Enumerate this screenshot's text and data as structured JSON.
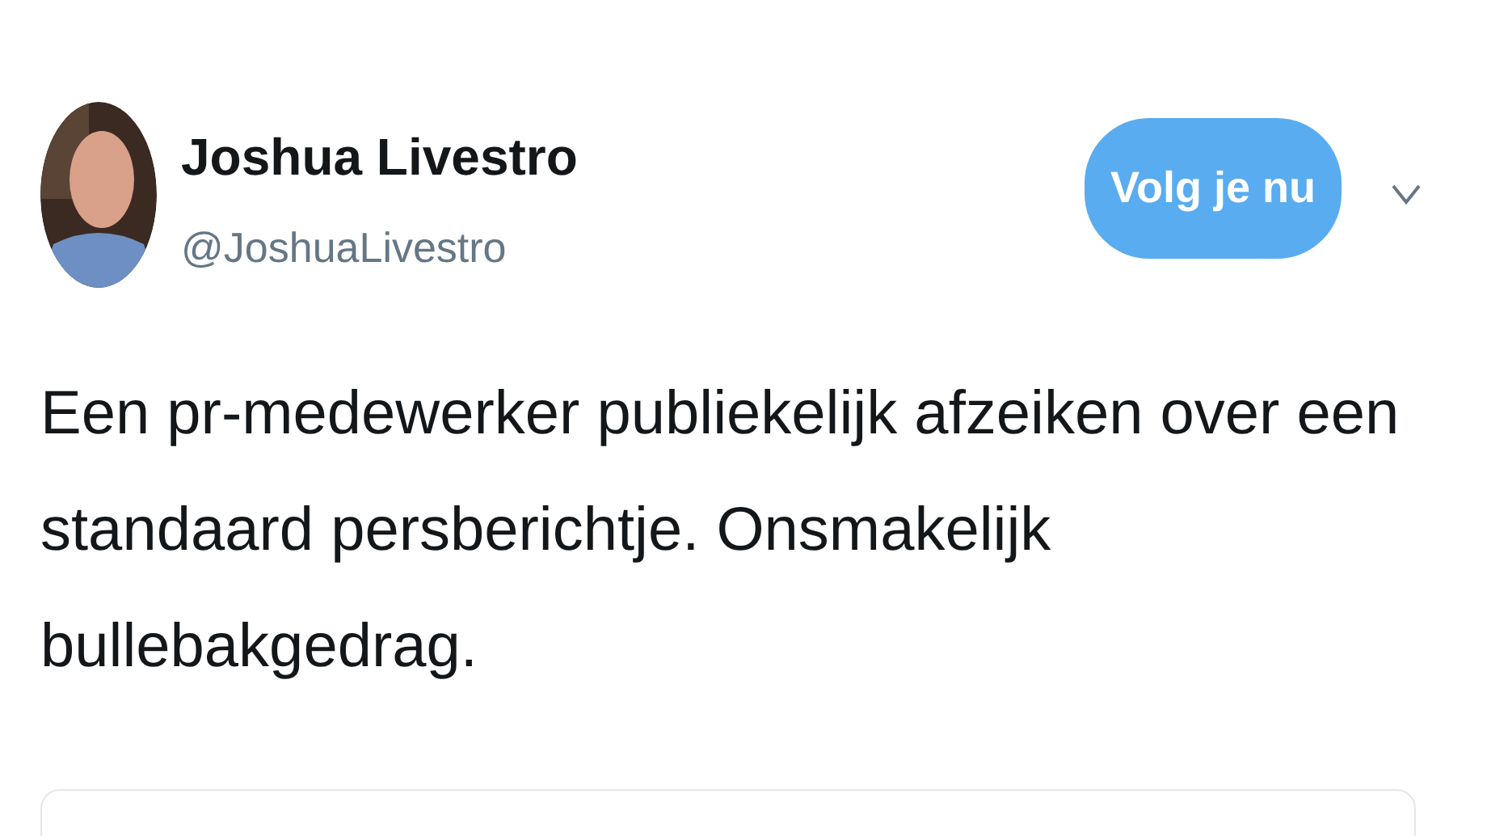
{
  "author": {
    "name": "Joshua Livestro",
    "handle": "@JoshuaLivestro"
  },
  "follow_button": {
    "label": "Volg je nu",
    "following": true
  },
  "tweet": {
    "text": "Een pr-medewerker publiekelijk afzeiken over een standaard persberichtje. Onsmakelijk bullebakgedrag."
  },
  "embedded_card": {
    "kind": "card"
  }
}
